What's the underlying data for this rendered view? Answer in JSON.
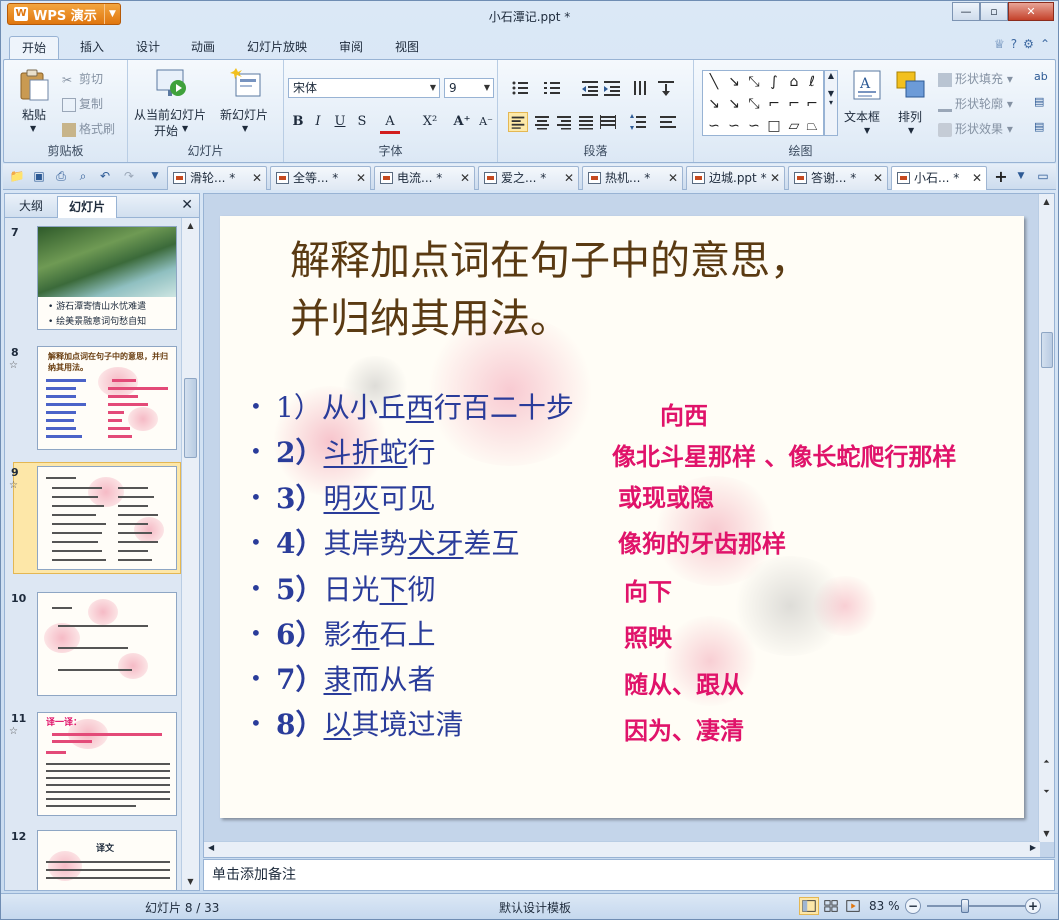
{
  "window": {
    "app_button": "WPS 演示",
    "title": "小石潭记.ppt *"
  },
  "menu": {
    "tabs": [
      "开始",
      "插入",
      "设计",
      "动画",
      "幻灯片放映",
      "审阅",
      "视图"
    ],
    "active": "开始"
  },
  "ribbon": {
    "clipboard": {
      "paste": "粘贴",
      "cut": "剪切",
      "copy": "复制",
      "format_painter": "格式刷",
      "label": "剪贴板"
    },
    "slides": {
      "from_current_line1": "从当前幻灯片",
      "from_current_line2": "开始",
      "new_slide": "新幻灯片",
      "label": "幻灯片"
    },
    "font": {
      "font_name": "宋体",
      "font_size": "9",
      "label": "字体"
    },
    "paragraph": {
      "label": "段落"
    },
    "drawing": {
      "textbox": "文本框",
      "arrange": "排列",
      "shape_fill": "形状填充",
      "shape_outline": "形状轮廓",
      "shape_effect": "形状效果",
      "label": "绘图"
    }
  },
  "doc_tabs": [
    {
      "label": "滑轮... *",
      "active": false
    },
    {
      "label": "全等... *",
      "active": false
    },
    {
      "label": "电流... *",
      "active": false
    },
    {
      "label": "爱之... *",
      "active": false
    },
    {
      "label": "热机... *",
      "active": false
    },
    {
      "label": "边城.ppt *",
      "active": false
    },
    {
      "label": "答谢... *",
      "active": false
    },
    {
      "label": "小石... *",
      "active": true
    }
  ],
  "left_pane": {
    "tabs": [
      "大纲",
      "幻灯片"
    ],
    "active_tab": "幻灯片",
    "thumbnails": [
      {
        "number": "7",
        "lines": [
          "• 游石潭寄情山水忧难遣",
          "• 绘美景融意词句愁自知"
        ]
      },
      {
        "number": "8",
        "title": "解释加点词在句子中的意思，并归纳其用法。"
      },
      {
        "number": "9"
      },
      {
        "number": "10"
      },
      {
        "number": "11",
        "title": "译一译："
      },
      {
        "number": "12",
        "title": "译文"
      }
    ],
    "selected": "9"
  },
  "slide": {
    "title_line1": "解释加点词在句子中的意思，",
    "title_line2": "并归纳其用法。",
    "items": [
      {
        "num": "1）",
        "pre": "从小丘",
        "u": "西",
        "post": "行百二十步",
        "answer": "向西"
      },
      {
        "num": "2）",
        "pre": "",
        "u": "斗折蛇",
        "post": "行",
        "answer": "像北斗星那样 、像长蛇爬行那样"
      },
      {
        "num": "3）",
        "pre": "",
        "u": "明灭",
        "post": "可见",
        "answer": "或现或隐"
      },
      {
        "num": "4）",
        "pre": "其岸势",
        "u": "犬牙",
        "post": "差互",
        "answer": "像狗的牙齿那样"
      },
      {
        "num": "5）",
        "pre": "日光",
        "u": "下",
        "post": "彻",
        "answer": "向下"
      },
      {
        "num": "6）",
        "pre": "影",
        "u": "布",
        "post": "石上",
        "answer": "照映"
      },
      {
        "num": "7）",
        "pre": "",
        "u": "隶",
        "post": "而从者",
        "answer": "随从、跟从"
      },
      {
        "num": "8）",
        "pre": "",
        "u": "以",
        "post": "其境过清",
        "answer": "因为、凄清"
      }
    ]
  },
  "notes_placeholder": "单击添加备注",
  "status": {
    "slide_position": "幻灯片 8 / 33",
    "template": "默认设计模板",
    "zoom": "83 %"
  },
  "colors": {
    "title_color": "#5a3a12",
    "item_color": "#2a3c9a",
    "answer_color": "#e0136a",
    "accent": "#e0760e"
  }
}
